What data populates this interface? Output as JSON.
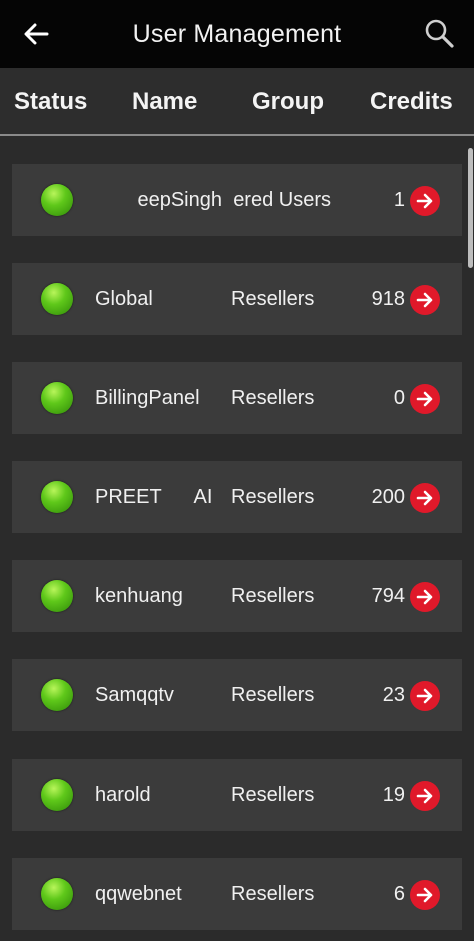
{
  "app_bar": {
    "title": "User Management",
    "back_icon": "arrow-left-icon",
    "search_icon": "search-icon"
  },
  "columns": {
    "status": "Status",
    "name": "Name",
    "group": "Group",
    "credits": "Credits"
  },
  "colors": {
    "status_online": "#5fc81a",
    "action_red": "#e0192a",
    "row_bg": "#3b3b3b",
    "app_bar_bg": "#050505"
  },
  "rows": [
    {
      "status": "online",
      "name": "eepSingh",
      "group": "ered Users",
      "credits": "1"
    },
    {
      "status": "online",
      "name": "Global",
      "group": "Resellers",
      "credits": "918"
    },
    {
      "status": "online",
      "name": "BillingPanel",
      "group": "Resellers",
      "credits": "0"
    },
    {
      "status": "online",
      "name": "PREET      AI",
      "group": "Resellers",
      "credits": "200"
    },
    {
      "status": "online",
      "name": "kenhuang",
      "group": "Resellers",
      "credits": "794"
    },
    {
      "status": "online",
      "name": "Samqqtv",
      "group": "Resellers",
      "credits": "23"
    },
    {
      "status": "online",
      "name": "harold",
      "group": "Resellers",
      "credits": "19"
    },
    {
      "status": "online",
      "name": "qqwebnet",
      "group": "Resellers",
      "credits": "6"
    }
  ]
}
